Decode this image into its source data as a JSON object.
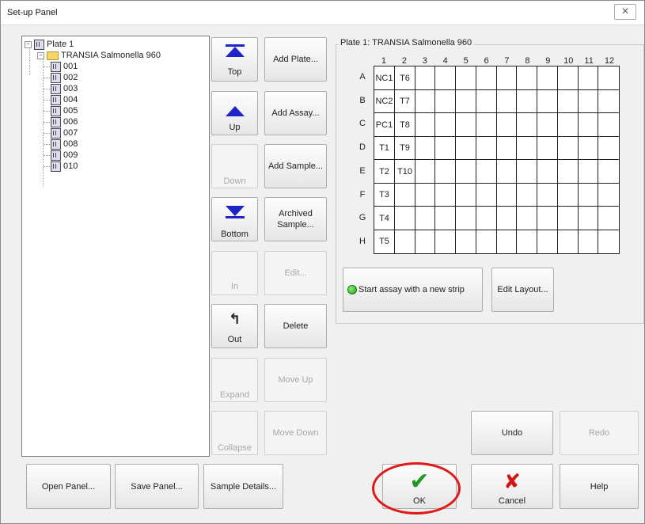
{
  "window": {
    "title": "Set-up Panel",
    "close_glyph": "✕"
  },
  "tree": {
    "root": {
      "label": "Plate 1",
      "expander": "−"
    },
    "assay": {
      "label": "TRANSIA Salmonella 960",
      "expander": "−"
    },
    "samples": [
      "001",
      "002",
      "003",
      "004",
      "005",
      "006",
      "007",
      "008",
      "009",
      "010"
    ]
  },
  "move_buttons": {
    "top": "Top",
    "up": "Up",
    "down": "Down",
    "bottom": "Bottom",
    "in": "In",
    "out": "Out",
    "out_glyph": "↰",
    "expand": "Expand",
    "collapse": "Collapse"
  },
  "action_buttons": {
    "add_plate": "Add Plate...",
    "add_assay": "Add Assay...",
    "add_sample": "Add Sample...",
    "archived_sample_1": "Archived",
    "archived_sample_2": "Sample...",
    "edit": "Edit...",
    "delete": "Delete",
    "move_up": "Move Up",
    "move_down": "Move Down"
  },
  "plate_group": {
    "title": "Plate 1: TRANSIA Salmonella 960",
    "columns": [
      "1",
      "2",
      "3",
      "4",
      "5",
      "6",
      "7",
      "8",
      "9",
      "10",
      "11",
      "12"
    ],
    "rows": [
      "A",
      "B",
      "C",
      "D",
      "E",
      "F",
      "G",
      "H"
    ],
    "cells": [
      [
        "NC1",
        "T6",
        "",
        "",
        "",
        "",
        "",
        "",
        "",
        "",
        "",
        ""
      ],
      [
        "NC2",
        "T7",
        "",
        "",
        "",
        "",
        "",
        "",
        "",
        "",
        "",
        ""
      ],
      [
        "PC1",
        "T8",
        "",
        "",
        "",
        "",
        "",
        "",
        "",
        "",
        "",
        ""
      ],
      [
        "T1",
        "T9",
        "",
        "",
        "",
        "",
        "",
        "",
        "",
        "",
        "",
        ""
      ],
      [
        "T2",
        "T10",
        "",
        "",
        "",
        "",
        "",
        "",
        "",
        "",
        "",
        ""
      ],
      [
        "T3",
        "",
        "",
        "",
        "",
        "",
        "",
        "",
        "",
        "",
        "",
        ""
      ],
      [
        "T4",
        "",
        "",
        "",
        "",
        "",
        "",
        "",
        "",
        "",
        "",
        ""
      ],
      [
        "T5",
        "",
        "",
        "",
        "",
        "",
        "",
        "",
        "",
        "",
        "",
        ""
      ]
    ],
    "start_assay": "Start assay with a new strip",
    "edit_layout": "Edit Layout..."
  },
  "history": {
    "undo": "Undo",
    "redo": "Redo"
  },
  "footer": {
    "open_panel": "Open Panel...",
    "save_panel": "Save Panel...",
    "sample_details": "Sample Details...",
    "ok": "OK",
    "ok_glyph": "✔",
    "cancel": "Cancel",
    "cancel_glyph": "✘",
    "help": "Help"
  },
  "colors": {
    "accent_blue": "#1f24c8",
    "highlight_red": "#e01818",
    "ok_green": "#1e9a1e"
  }
}
